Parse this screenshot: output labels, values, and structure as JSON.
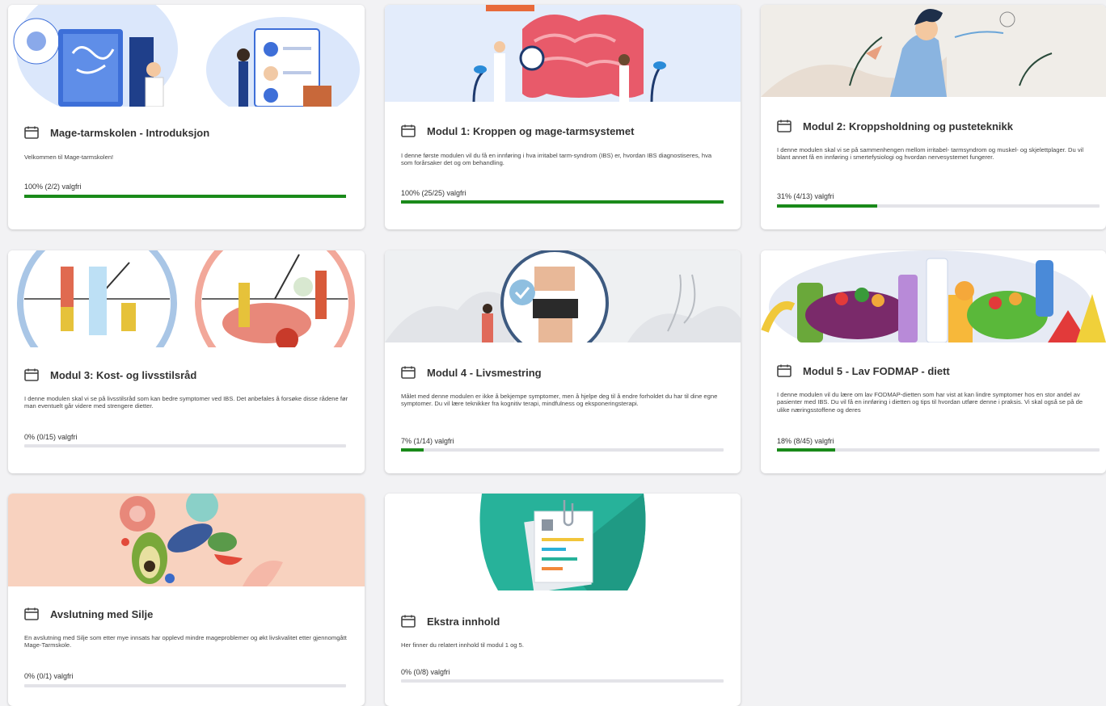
{
  "cards": [
    {
      "title": "Mage-tarmskolen - Introduksjon",
      "description": "Velkommen til Mage-tarmskolen!",
      "progress_label": "100% (2/2) valgfri",
      "progress": 1.0,
      "image": "intestine-doctor-illustration"
    },
    {
      "title": "Modul 1: Kroppen og mage-tarmsystemet",
      "description": "I denne første modulen vil du få en innføring i hva irritabel tarm-syndrom (IBS) er, hvordan IBS diagnostiseres, hva som forårsaker det og om behandling.",
      "progress_label": "100% (25/25) valgfri",
      "progress": 1.0,
      "image": "digestive-system-illustration"
    },
    {
      "title": "Modul 2: Kroppsholdning og pusteteknikk",
      "description": "I denne modulen skal vi se på sammenhengen mellom irritabel- tarmsyndrom og muskel- og skjelettplager. Du vil blant annet få en innføring i smertefysiologi og hvordan nervesystemet fungerer.",
      "progress_label": "31% (4/13) valgfri",
      "progress": 0.31,
      "image": "breathing-woman-illustration"
    },
    {
      "title": "Modul 3: Kost- og livsstilsråd",
      "description": "I denne modulen skal vi se på livsstilsråd som kan bedre symptomer ved IBS. Det anbefales å forsøke disse rådene før man eventuelt går videre med strengere dietter.",
      "progress_label": "0% (0/15) valgfri",
      "progress": 0.0,
      "image": "clocks-lifestyle-illustration"
    },
    {
      "title": "Modul 4 - Livsmestring",
      "description": "Målet med denne modulen er ikke å bekjempe symptomer, men å hjelpe deg til å endre forholdet du har til dine egne symptomer. Du vil lære teknikker fra kognitiv terapi, mindfulness og eksponeringsterapi.",
      "progress_label": "7% (1/14) valgfri",
      "progress": 0.07,
      "image": "body-scan-illustration"
    },
    {
      "title": "Modul 5 - Lav FODMAP - diett",
      "description": "I denne modulen vil du lære om lav FODMAP-dietten som har vist at kan lindre symptomer hos en stor andel av pasienter med IBS. Du vil få en innføring i dietten og tips til hvordan utføre denne i praksis. Vi skal også se på de ulike næringsstoffene og deres",
      "progress_label": "18% (8/45) valgfri",
      "progress": 0.18,
      "image": "healthy-food-illustration"
    },
    {
      "title": "Avslutning med Silje",
      "description": "En avslutning med Silje som etter mye innsats har opplevd mindre mageproblemer og økt livskvalitet etter gjennomgått Mage-Tarmskole.",
      "progress_label": "0% (0/1) valgfri",
      "progress": 0.0,
      "image": "food-collage-illustration"
    },
    {
      "title": "Ekstra innhold",
      "description": "Her finner du relatert innhold til modul 1 og 5.",
      "progress_label": "0% (0/8) valgfri",
      "progress": 0.0,
      "image": "documents-illustration"
    }
  ],
  "colors": {
    "progress_fill": "#1a8a1a",
    "progress_track": "#e3e3e8",
    "page_bg": "#f2f2f4"
  }
}
